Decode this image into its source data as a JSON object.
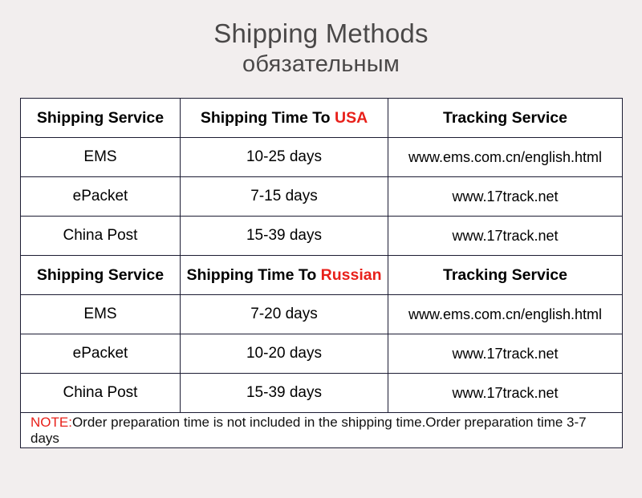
{
  "title": {
    "main": "Shipping Methods",
    "sub": "обязательным"
  },
  "colors": {
    "accent_red": "#e8201a",
    "title_gray": "#4a4848",
    "border": "#1c1c33",
    "page_background": "#f2eeee",
    "table_background": "#ffffff"
  },
  "table": {
    "sections": [
      {
        "header": {
          "service": "Shipping Service",
          "time_prefix": "Shipping Time To ",
          "time_region": "USA",
          "tracking": "Tracking Service"
        },
        "rows": [
          {
            "service": "EMS",
            "time": "10-25 days",
            "tracking": "www.ems.com.cn/english.html"
          },
          {
            "service": "ePacket",
            "time": "7-15 days",
            "tracking": "www.17track.net"
          },
          {
            "service": "China Post",
            "time": "15-39 days",
            "tracking": "www.17track.net"
          }
        ]
      },
      {
        "header": {
          "service": "Shipping Service",
          "time_prefix": "Shipping Time To ",
          "time_region": "Russian",
          "tracking": "Tracking Service"
        },
        "rows": [
          {
            "service": "EMS",
            "time": "7-20 days",
            "tracking": "www.ems.com.cn/english.html"
          },
          {
            "service": "ePacket",
            "time": "10-20 days",
            "tracking": "www.17track.net"
          },
          {
            "service": "China Post",
            "time": "15-39 days",
            "tracking": "www.17track.net"
          }
        ]
      }
    ],
    "note": {
      "label": "NOTE:",
      "text": "Order preparation time is not included in the shipping time.Order preparation time 3-7 days"
    }
  }
}
